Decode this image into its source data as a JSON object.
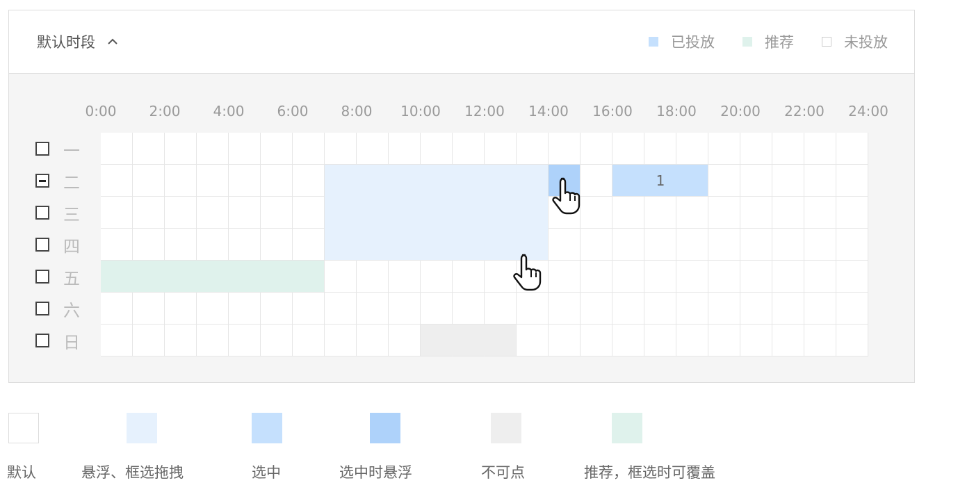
{
  "header": {
    "title": "默认时段",
    "collapse_icon": "chevron-up-icon",
    "legend": [
      {
        "label": "已投放",
        "color": "#c5e0fd"
      },
      {
        "label": "推荐",
        "color": "#dff2ec"
      },
      {
        "label": "未投放",
        "color": "#ffffff"
      }
    ]
  },
  "schedule": {
    "hour_labels": [
      "0:00",
      "2:00",
      "4:00",
      "6:00",
      "8:00",
      "10:00",
      "12:00",
      "14:00",
      "16:00",
      "18:00",
      "20:00",
      "22:00",
      "24:00"
    ],
    "days": [
      {
        "label": "一",
        "checkbox": "unchecked"
      },
      {
        "label": "二",
        "checkbox": "indeterminate"
      },
      {
        "label": "三",
        "checkbox": "unchecked"
      },
      {
        "label": "四",
        "checkbox": "unchecked"
      },
      {
        "label": "五",
        "checkbox": "unchecked"
      },
      {
        "label": "六",
        "checkbox": "unchecked"
      },
      {
        "label": "日",
        "checkbox": "unchecked"
      }
    ],
    "cell_states": {
      "hover_drag": {
        "day_from": 1,
        "day_to": 3,
        "col_from": 7,
        "col_to": 13
      },
      "selected": {
        "day": 1,
        "col_from": 16,
        "col_to": 18,
        "label": "1"
      },
      "selected_hover": {
        "day": 1,
        "col": 14
      },
      "recommended": {
        "day": 4,
        "col_from": 0,
        "col_to": 6
      },
      "disabled": {
        "day": 6,
        "col_from": 10,
        "col_to": 12
      }
    },
    "colors": {
      "default": "#ffffff",
      "hover_drag": "#e6f1fd",
      "selected": "#c5e0fd",
      "selected_hover": "#aed2fa",
      "disabled": "#eeeeee",
      "recommended": "#dff2ec"
    }
  },
  "state_legend": [
    {
      "label": "默认",
      "color": "#ffffff"
    },
    {
      "label": "悬浮、框选拖拽",
      "color": "#e6f1fd"
    },
    {
      "label": "选中",
      "color": "#c5e0fd"
    },
    {
      "label": "选中时悬浮",
      "color": "#aed2fa"
    },
    {
      "label": "不可点",
      "color": "#eeeeee"
    },
    {
      "label": "推荐，框选时可覆盖",
      "color": "#dff2ec"
    }
  ]
}
